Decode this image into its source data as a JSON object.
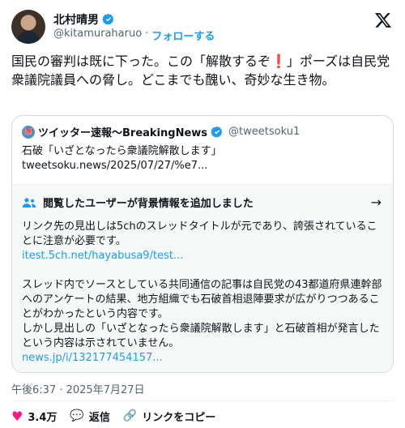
{
  "user": {
    "name": "北村晴男",
    "handle": "@kitamuraharuo",
    "separator": "·",
    "follow_label": "フォローする"
  },
  "post": {
    "text": "国民の審判は既に下った。この「解散するぞ❗」ポーズは自民党衆議院議員への脅し。どこまでも醜い、奇妙な生き物。"
  },
  "quote": {
    "icon_glyph": "🐙",
    "name": "ツイッター速報〜BreakingNews",
    "handle": "@tweetsoku1",
    "text": "石破「いざとなったら衆議院解散します」",
    "link": "tweetsoku.news/2025/07/27/%e7..."
  },
  "community_note": {
    "header": "閲覧したユーザーが背景情報を追加しました",
    "para1": "リンク先の見出しは5chのスレッドタイトルが元であり、誇張されていることに注意が必要です。",
    "link1": "itest.5ch.net/hayabusa9/test...",
    "para2": "スレッド内でソースとしている共同通信の記事は自民党の43都道府県連幹部へのアンケートの結果、地方組織でも石破首相退陣要求が広がりつつあることがわかったという内容です。",
    "para3": "しかし見出しの「いざとなったら衆議院解散します」と石破首相が発言したという内容は示されていません。",
    "link2": "news.jp/i/132177454157..."
  },
  "timestamp": "午後6:37 · 2025年7月27日",
  "actions": {
    "likes": "3.4万",
    "reply_label": "返信",
    "copy_link_label": "リンクをコピー"
  },
  "colors": {
    "accent": "#1d9bf0",
    "like": "#f91880",
    "secondary_text": "#536471"
  },
  "icons": [
    "verified-icon",
    "x-logo-icon",
    "people-icon",
    "arrow-right-icon",
    "heart-icon",
    "reply-icon",
    "link-icon"
  ]
}
